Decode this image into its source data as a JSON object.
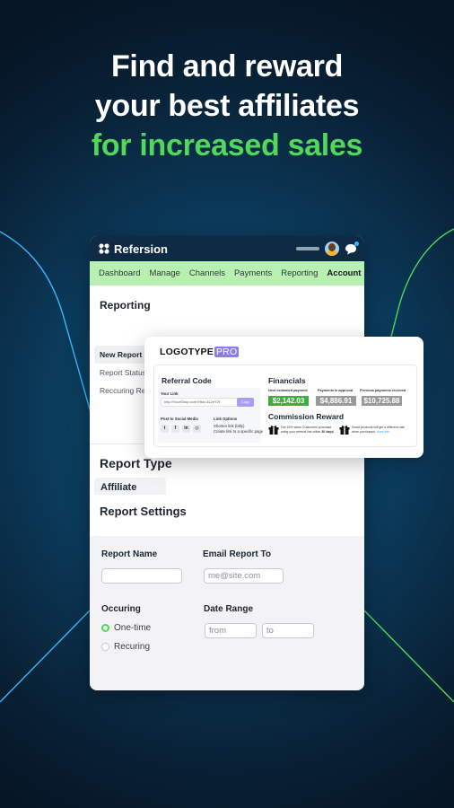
{
  "headline": {
    "line1": "Find and reward",
    "line2": "your best affiliates",
    "line3": "for increased sales"
  },
  "colors": {
    "accent_green": "#4fd85a",
    "nav_bg": "#b7f0b0",
    "topbar_bg": "#0e2a44",
    "pro_purple": "#8b7cf6",
    "line_blue": "#38b6ff"
  },
  "app": {
    "brand": "Refersion",
    "nav": [
      "Dashboard",
      "Manage",
      "Channels",
      "Payments",
      "Reporting",
      "Account"
    ],
    "nav_active": "Account",
    "nav_more": "⋮",
    "reporting_title": "Reporting",
    "side_items": [
      "New Report",
      "Report Status",
      "Reccuring Reports"
    ],
    "report_type_title": "Report Type",
    "report_type_value": "Affiliate",
    "settings_title": "Report Settings",
    "form": {
      "report_name_label": "Report Name",
      "report_name_value": "",
      "email_label": "Email Report To",
      "email_placeholder": "me@site.com",
      "occurring_label": "Occuring",
      "options": [
        "One-time",
        "Recuring"
      ],
      "selected_option": "One-time",
      "date_range_label": "Date Range",
      "from_placeholder": "from",
      "to_placeholder": "to"
    }
  },
  "widget": {
    "logo": "LOGOTYPE",
    "logo_badge": "PRO",
    "referral_title": "Referral Code",
    "your_link_label": "Your Link",
    "link_value": "http://YourShop.com?rfsn=112eY2t",
    "copy_label": "Copy",
    "social_label": "Post to Social Media",
    "social_icons": [
      "twitter-icon",
      "facebook-icon",
      "linkedin-icon",
      "instagram-icon"
    ],
    "social_glyphs": [
      "t",
      "f",
      "in",
      "◎"
    ],
    "link_options_label": "Link Options",
    "link_options": [
      "Shorten link (bitly)",
      "Create link to a specific page"
    ],
    "financials_title": "Financials",
    "financials": [
      {
        "label": "Next estimated payment",
        "value": "$2,142.03",
        "color": "#3fae3f"
      },
      {
        "label": "Payments in approval",
        "value": "$4,886.91",
        "color": "#9a9a9a"
      },
      {
        "label": "Previous payments received",
        "value": "$10,725.88",
        "color": "#9a9a9a"
      }
    ],
    "commission_title": "Commission Reward",
    "commission_items": [
      {
        "text": "Get 15% when Customers purchase using your referral link within",
        "bold": "30 days!",
        "link": ""
      },
      {
        "text": "Some products will get a different rate when purchased.",
        "bold": "",
        "link": "More info"
      }
    ]
  }
}
